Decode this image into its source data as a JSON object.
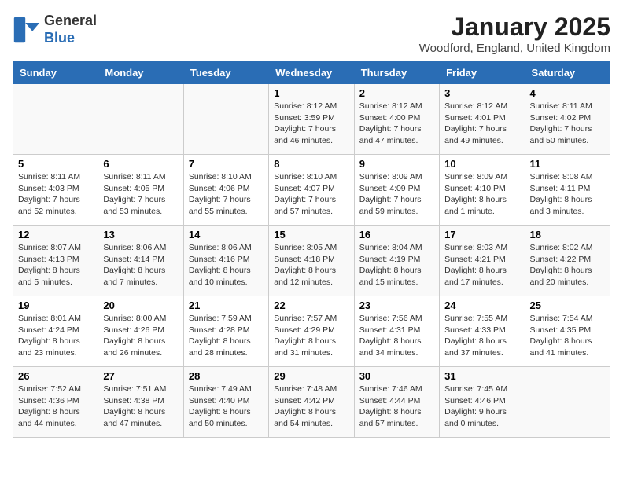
{
  "header": {
    "logo_general": "General",
    "logo_blue": "Blue",
    "month_title": "January 2025",
    "location": "Woodford, England, United Kingdom"
  },
  "days_of_week": [
    "Sunday",
    "Monday",
    "Tuesday",
    "Wednesday",
    "Thursday",
    "Friday",
    "Saturday"
  ],
  "weeks": [
    [
      {
        "day": "",
        "info": ""
      },
      {
        "day": "",
        "info": ""
      },
      {
        "day": "",
        "info": ""
      },
      {
        "day": "1",
        "info": "Sunrise: 8:12 AM\nSunset: 3:59 PM\nDaylight: 7 hours and 46 minutes."
      },
      {
        "day": "2",
        "info": "Sunrise: 8:12 AM\nSunset: 4:00 PM\nDaylight: 7 hours and 47 minutes."
      },
      {
        "day": "3",
        "info": "Sunrise: 8:12 AM\nSunset: 4:01 PM\nDaylight: 7 hours and 49 minutes."
      },
      {
        "day": "4",
        "info": "Sunrise: 8:11 AM\nSunset: 4:02 PM\nDaylight: 7 hours and 50 minutes."
      }
    ],
    [
      {
        "day": "5",
        "info": "Sunrise: 8:11 AM\nSunset: 4:03 PM\nDaylight: 7 hours and 52 minutes."
      },
      {
        "day": "6",
        "info": "Sunrise: 8:11 AM\nSunset: 4:05 PM\nDaylight: 7 hours and 53 minutes."
      },
      {
        "day": "7",
        "info": "Sunrise: 8:10 AM\nSunset: 4:06 PM\nDaylight: 7 hours and 55 minutes."
      },
      {
        "day": "8",
        "info": "Sunrise: 8:10 AM\nSunset: 4:07 PM\nDaylight: 7 hours and 57 minutes."
      },
      {
        "day": "9",
        "info": "Sunrise: 8:09 AM\nSunset: 4:09 PM\nDaylight: 7 hours and 59 minutes."
      },
      {
        "day": "10",
        "info": "Sunrise: 8:09 AM\nSunset: 4:10 PM\nDaylight: 8 hours and 1 minute."
      },
      {
        "day": "11",
        "info": "Sunrise: 8:08 AM\nSunset: 4:11 PM\nDaylight: 8 hours and 3 minutes."
      }
    ],
    [
      {
        "day": "12",
        "info": "Sunrise: 8:07 AM\nSunset: 4:13 PM\nDaylight: 8 hours and 5 minutes."
      },
      {
        "day": "13",
        "info": "Sunrise: 8:06 AM\nSunset: 4:14 PM\nDaylight: 8 hours and 7 minutes."
      },
      {
        "day": "14",
        "info": "Sunrise: 8:06 AM\nSunset: 4:16 PM\nDaylight: 8 hours and 10 minutes."
      },
      {
        "day": "15",
        "info": "Sunrise: 8:05 AM\nSunset: 4:18 PM\nDaylight: 8 hours and 12 minutes."
      },
      {
        "day": "16",
        "info": "Sunrise: 8:04 AM\nSunset: 4:19 PM\nDaylight: 8 hours and 15 minutes."
      },
      {
        "day": "17",
        "info": "Sunrise: 8:03 AM\nSunset: 4:21 PM\nDaylight: 8 hours and 17 minutes."
      },
      {
        "day": "18",
        "info": "Sunrise: 8:02 AM\nSunset: 4:22 PM\nDaylight: 8 hours and 20 minutes."
      }
    ],
    [
      {
        "day": "19",
        "info": "Sunrise: 8:01 AM\nSunset: 4:24 PM\nDaylight: 8 hours and 23 minutes."
      },
      {
        "day": "20",
        "info": "Sunrise: 8:00 AM\nSunset: 4:26 PM\nDaylight: 8 hours and 26 minutes."
      },
      {
        "day": "21",
        "info": "Sunrise: 7:59 AM\nSunset: 4:28 PM\nDaylight: 8 hours and 28 minutes."
      },
      {
        "day": "22",
        "info": "Sunrise: 7:57 AM\nSunset: 4:29 PM\nDaylight: 8 hours and 31 minutes."
      },
      {
        "day": "23",
        "info": "Sunrise: 7:56 AM\nSunset: 4:31 PM\nDaylight: 8 hours and 34 minutes."
      },
      {
        "day": "24",
        "info": "Sunrise: 7:55 AM\nSunset: 4:33 PM\nDaylight: 8 hours and 37 minutes."
      },
      {
        "day": "25",
        "info": "Sunrise: 7:54 AM\nSunset: 4:35 PM\nDaylight: 8 hours and 41 minutes."
      }
    ],
    [
      {
        "day": "26",
        "info": "Sunrise: 7:52 AM\nSunset: 4:36 PM\nDaylight: 8 hours and 44 minutes."
      },
      {
        "day": "27",
        "info": "Sunrise: 7:51 AM\nSunset: 4:38 PM\nDaylight: 8 hours and 47 minutes."
      },
      {
        "day": "28",
        "info": "Sunrise: 7:49 AM\nSunset: 4:40 PM\nDaylight: 8 hours and 50 minutes."
      },
      {
        "day": "29",
        "info": "Sunrise: 7:48 AM\nSunset: 4:42 PM\nDaylight: 8 hours and 54 minutes."
      },
      {
        "day": "30",
        "info": "Sunrise: 7:46 AM\nSunset: 4:44 PM\nDaylight: 8 hours and 57 minutes."
      },
      {
        "day": "31",
        "info": "Sunrise: 7:45 AM\nSunset: 4:46 PM\nDaylight: 9 hours and 0 minutes."
      },
      {
        "day": "",
        "info": ""
      }
    ]
  ]
}
